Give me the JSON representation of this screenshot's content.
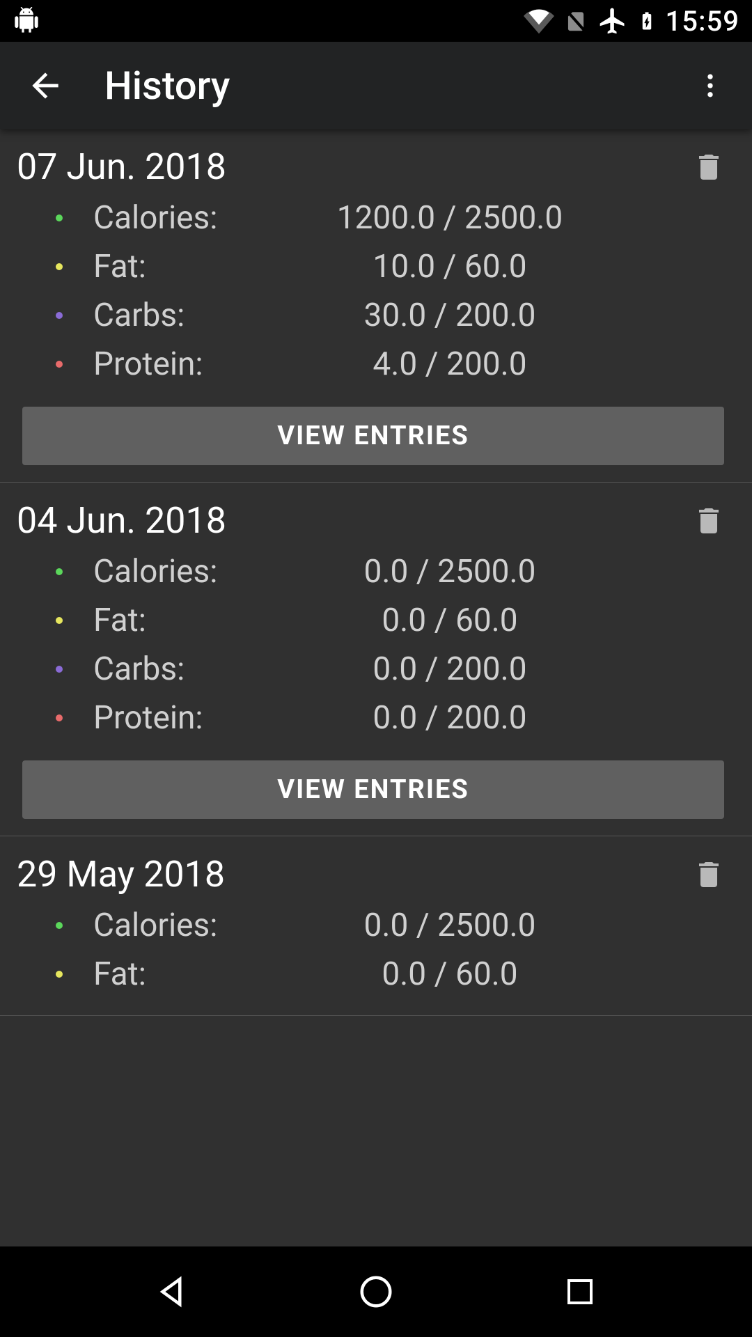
{
  "statusbar": {
    "clock": "15:59"
  },
  "appbar": {
    "title": "History"
  },
  "labels": {
    "view_entries": "VIEW ENTRIES"
  },
  "metric_colors": {
    "calories": "#5bd75b",
    "fat": "#e6e65e",
    "carbs": "#8a6bd6",
    "protein": "#e86b6b"
  },
  "days": [
    {
      "date": "07 Jun. 2018",
      "metrics": [
        {
          "key": "calories",
          "label": "Calories:",
          "value": "1200.0 / 2500.0"
        },
        {
          "key": "fat",
          "label": "Fat:",
          "value": "10.0 / 60.0"
        },
        {
          "key": "carbs",
          "label": "Carbs:",
          "value": "30.0 / 200.0"
        },
        {
          "key": "protein",
          "label": "Protein:",
          "value": "4.0 / 200.0"
        }
      ]
    },
    {
      "date": "04 Jun. 2018",
      "metrics": [
        {
          "key": "calories",
          "label": "Calories:",
          "value": "0.0 / 2500.0"
        },
        {
          "key": "fat",
          "label": "Fat:",
          "value": "0.0 / 60.0"
        },
        {
          "key": "carbs",
          "label": "Carbs:",
          "value": "0.0 / 200.0"
        },
        {
          "key": "protein",
          "label": "Protein:",
          "value": "0.0 / 200.0"
        }
      ]
    },
    {
      "date": "29 May 2018",
      "metrics": [
        {
          "key": "calories",
          "label": "Calories:",
          "value": "0.0 / 2500.0"
        },
        {
          "key": "fat",
          "label": "Fat:",
          "value": "0.0 / 60.0"
        }
      ]
    }
  ]
}
